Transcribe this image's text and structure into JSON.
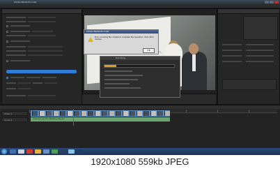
{
  "window": {
    "title": "Adobe Media Encoder"
  },
  "error_dialog": {
    "title": "Adobe Media Encoder",
    "message": "Error encoding file. Unable to complete the operation. Click OK to dismiss.",
    "ok_label": "OK",
    "icon": "warning-icon"
  },
  "encoding_dialog": {
    "title": "Encoding",
    "progress": 0.17,
    "progress_color": "#d9a01d"
  },
  "export_settings": {
    "accent_color": "#2f7cd6"
  },
  "timeline": {
    "video_track_label": "Video 1",
    "audio_track_label": "Audio 1",
    "audio_clip_label": "ceremony_to_Film_Wedding_Italy.avi"
  },
  "caption": {
    "text": "1920x1080  559kb JPEG"
  }
}
